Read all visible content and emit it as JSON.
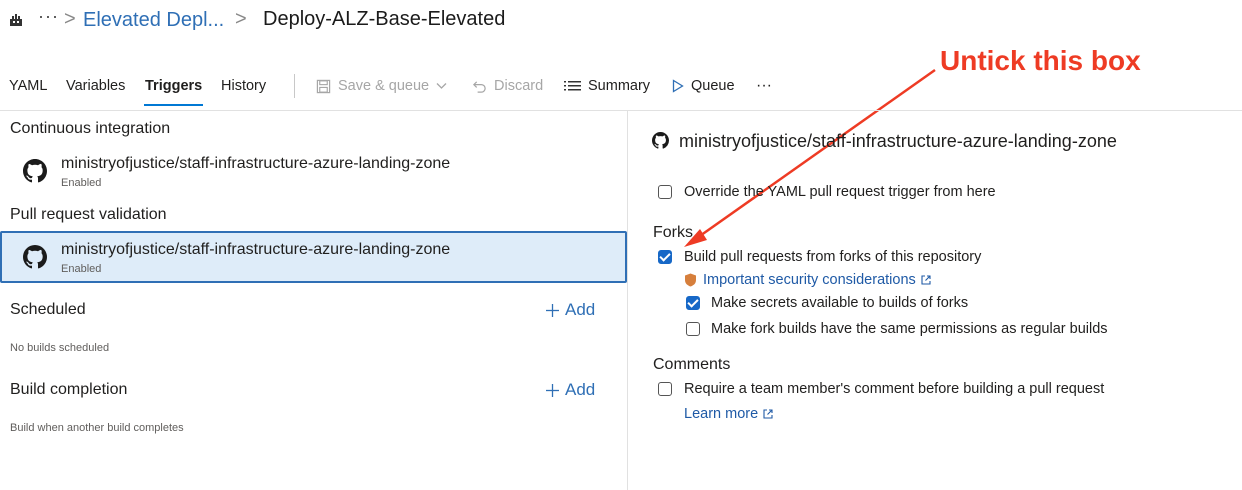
{
  "breadcrumb": {
    "more": "···",
    "sep": ">",
    "pipeline_group": "Elevated Depl...",
    "pipeline_name": "Deploy-ALZ-Base-Elevated"
  },
  "tabs": [
    {
      "label": "YAML"
    },
    {
      "label": "Variables"
    },
    {
      "label": "Triggers",
      "active": true
    },
    {
      "label": "History"
    }
  ],
  "toolbar": {
    "save_queue": "Save & queue",
    "discard": "Discard",
    "summary": "Summary",
    "queue": "Queue",
    "more": "···"
  },
  "left": {
    "ci": {
      "title": "Continuous integration",
      "repo": "ministryofjustice/staff-infrastructure-azure-landing-zone",
      "status": "Enabled"
    },
    "pr": {
      "title": "Pull request validation",
      "repo": "ministryofjustice/staff-infrastructure-azure-landing-zone",
      "status": "Enabled"
    },
    "scheduled": {
      "title": "Scheduled",
      "add": "Add",
      "empty": "No builds scheduled"
    },
    "build_completion": {
      "title": "Build completion",
      "add": "Add",
      "empty": "Build when another build completes"
    }
  },
  "right": {
    "repo": "ministryofjustice/staff-infrastructure-azure-landing-zone",
    "override": {
      "label": "Override the YAML pull request trigger from here",
      "checked": false
    },
    "forks": {
      "title": "Forks",
      "build_from_forks": {
        "label": "Build pull requests from forks of this repository",
        "checked": true
      },
      "security_link": "Important security considerations",
      "secrets": {
        "label": "Make secrets available to builds of forks",
        "checked": true
      },
      "permissions": {
        "label": "Make fork builds have the same permissions as regular builds",
        "checked": false
      }
    },
    "comments": {
      "title": "Comments",
      "require": {
        "label": "Require a team member's comment before building a pull request",
        "checked": false
      },
      "learn_more": "Learn more"
    }
  },
  "annotation": {
    "text": "Untick this box",
    "color": "#ee3b24"
  },
  "colors": {
    "accent": "#0078d4",
    "link": "#2f6fb5",
    "checkbox": "#1768c7",
    "selected_row": "#deecf9"
  }
}
